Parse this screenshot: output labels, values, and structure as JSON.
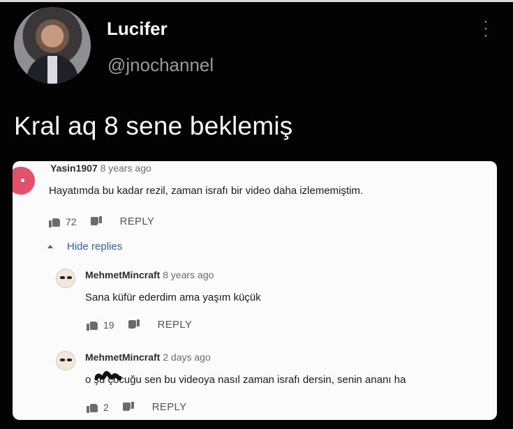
{
  "tweet": {
    "display_name": "Lucifer",
    "handle": "@jnochannel",
    "text": "Kral aq 8 sene beklemiş"
  },
  "comments": {
    "top": {
      "author": "Yasin1907",
      "time": "8 years ago",
      "text": "Hayatımda bu kadar rezil, zaman israfı bir video daha izlememiştim.",
      "likes": "72",
      "reply_label": "REPLY"
    },
    "hide_replies_label": "Hide replies",
    "replies": [
      {
        "author": "MehmetMincraft",
        "time": "8 years ago",
        "text": "Sana küfür ederdim ama yaşım küçük",
        "likes": "19",
        "reply_label": "REPLY"
      },
      {
        "author": "MehmetMincraft",
        "time": "2 days ago",
        "text": "o      şu çocuğu sen bu videoya nasıl zaman israfı dersin, senin ananı ha",
        "likes": "2",
        "reply_label": "REPLY"
      }
    ]
  },
  "colors": {
    "background": "#030303",
    "link_blue": "#2d63b3",
    "card": "#fbfbfb"
  },
  "icons": [
    "more-vertical-icon",
    "like-icon",
    "dislike-icon",
    "caret-up-icon"
  ]
}
